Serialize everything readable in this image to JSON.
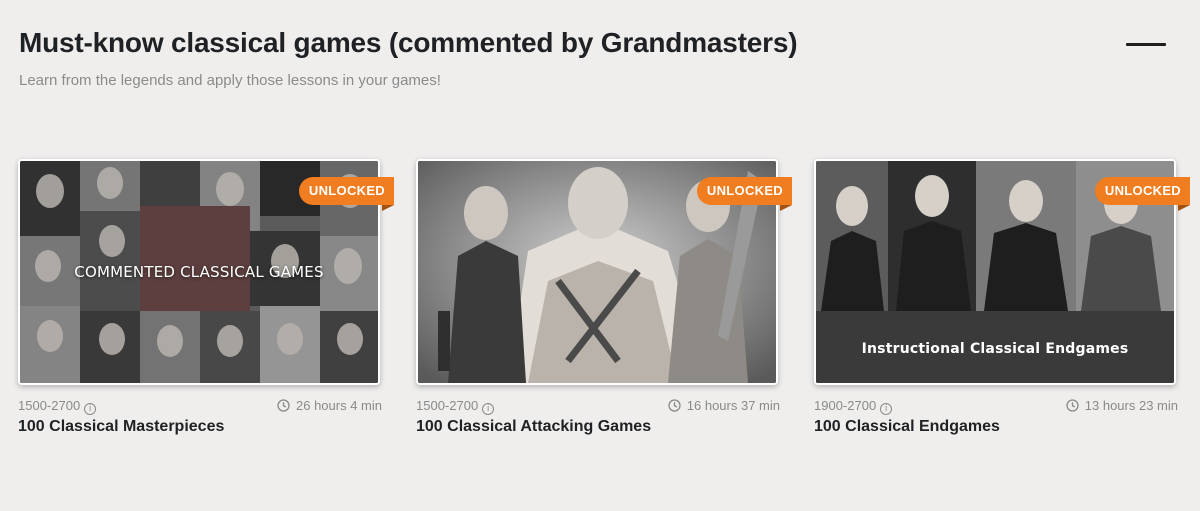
{
  "section": {
    "title": "Must-know classical games (commented by Grandmasters)",
    "subtitle": "Learn from the legends and apply those lessons in your games!"
  },
  "icons": {
    "collapse": "minus-icon",
    "info": "info-icon",
    "duration": "clock-icon"
  },
  "colors": {
    "badge": "#f07d1f",
    "background": "#efeeed"
  },
  "courses": [
    {
      "title": "100 Classical Masterpieces",
      "rating": "1500-2700",
      "duration": "26 hours 4 min",
      "badge": "UNLOCKED",
      "overlay": "COMMENTED CLASSICAL GAMES"
    },
    {
      "title": "100 Classical Attacking Games",
      "rating": "1500-2700",
      "duration": "16 hours 37 min",
      "badge": "UNLOCKED",
      "overlay": ""
    },
    {
      "title": "100 Classical Endgames",
      "rating": "1900-2700",
      "duration": "13 hours 23 min",
      "badge": "UNLOCKED",
      "overlay": "Instructional Classical Endgames"
    }
  ]
}
